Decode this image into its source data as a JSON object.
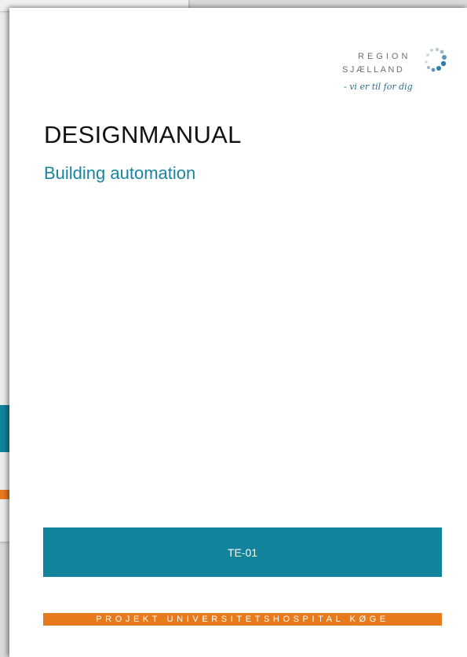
{
  "logo": {
    "line1": "REGION",
    "line2": "SJÆLLAND",
    "tagline": "- vi er til for dig"
  },
  "document": {
    "title": "DESIGNMANUAL",
    "subtitle": "Building automation",
    "code": "TE-01",
    "project": "PROJEKT UNIVERSITETSHOSPITAL KØGE"
  },
  "colors": {
    "accent_teal": "#11839b",
    "accent_orange": "#e87a1e",
    "subtitle_teal": "#1a84a0"
  }
}
